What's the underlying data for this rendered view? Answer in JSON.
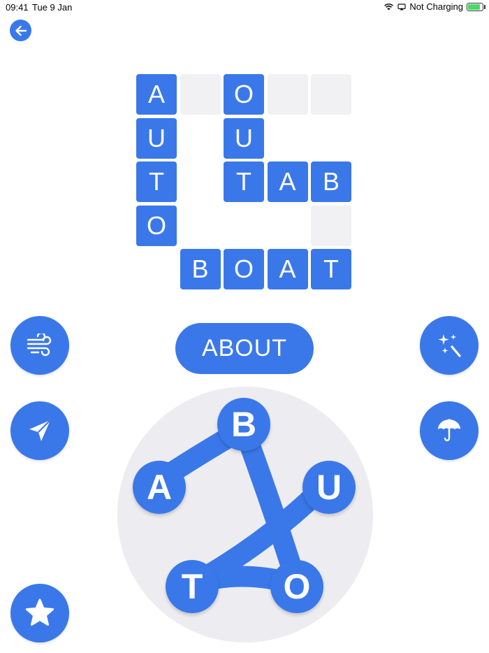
{
  "status_bar": {
    "time": "09:41",
    "date": "Tue 9 Jan",
    "charging_text": "Not Charging"
  },
  "back_button": {
    "icon": "arrow-left-icon"
  },
  "grid": {
    "cells": [
      {
        "row": 0,
        "col": 0,
        "letter": "A"
      },
      {
        "row": 0,
        "col": 1,
        "letter": ""
      },
      {
        "row": 0,
        "col": 2,
        "letter": "O"
      },
      {
        "row": 0,
        "col": 3,
        "letter": ""
      },
      {
        "row": 0,
        "col": 4,
        "letter": ""
      },
      {
        "row": 1,
        "col": 0,
        "letter": "U"
      },
      {
        "row": 1,
        "col": 2,
        "letter": "U"
      },
      {
        "row": 2,
        "col": 0,
        "letter": "T"
      },
      {
        "row": 2,
        "col": 2,
        "letter": "T"
      },
      {
        "row": 2,
        "col": 3,
        "letter": "A"
      },
      {
        "row": 2,
        "col": 4,
        "letter": "B"
      },
      {
        "row": 3,
        "col": 0,
        "letter": "O"
      },
      {
        "row": 3,
        "col": 4,
        "letter": ""
      },
      {
        "row": 4,
        "col": 1,
        "letter": "B"
      },
      {
        "row": 4,
        "col": 2,
        "letter": "O"
      },
      {
        "row": 4,
        "col": 3,
        "letter": "A"
      },
      {
        "row": 4,
        "col": 4,
        "letter": "T"
      }
    ]
  },
  "current_word": "ABOUT",
  "side_buttons": {
    "shuffle": {
      "icon": "wind-icon"
    },
    "hint": {
      "icon": "magic-wand-icon"
    },
    "share": {
      "icon": "paper-plane-icon"
    },
    "protect": {
      "icon": "umbrella-icon"
    },
    "favorite": {
      "icon": "star-icon"
    }
  },
  "wheel": {
    "letters": [
      "B",
      "U",
      "O",
      "T",
      "A"
    ],
    "selected_path": [
      "A",
      "B",
      "O",
      "T",
      "U"
    ]
  },
  "colors": {
    "accent": "#3a78ea",
    "empty_cell": "#f1f1f4",
    "wheel_bg": "#ededf1"
  }
}
